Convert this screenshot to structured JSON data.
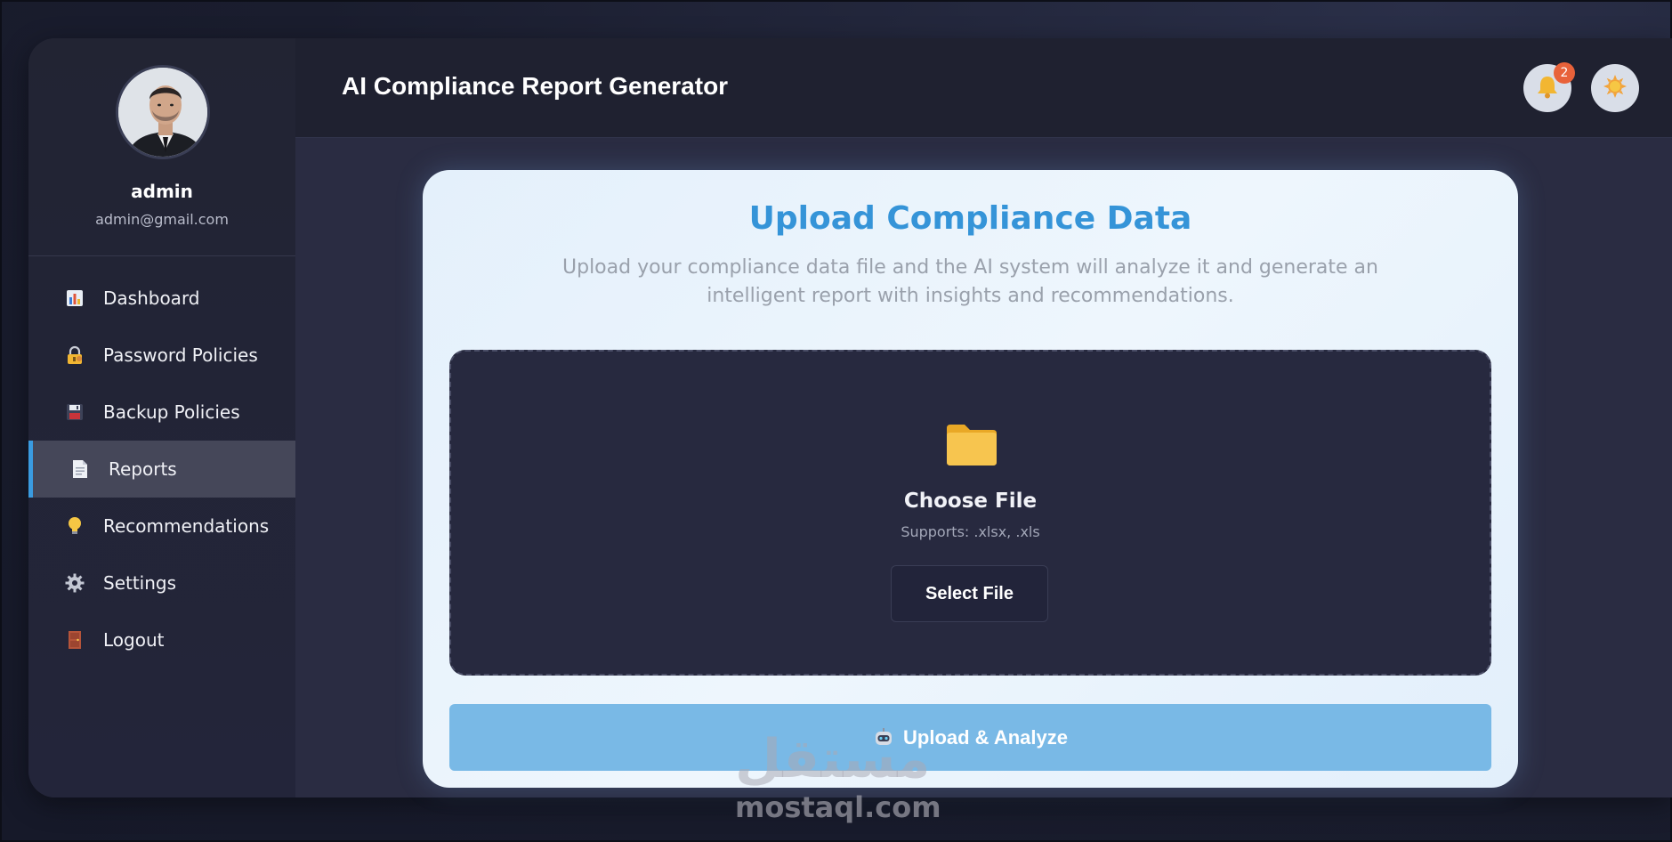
{
  "header": {
    "title": "AI Compliance Report Generator",
    "notification_count": "2"
  },
  "profile": {
    "name": "admin",
    "email": "admin@gmail.com"
  },
  "sidebar": {
    "items": [
      {
        "label": "Dashboard",
        "icon": "bar-chart-icon",
        "active": false
      },
      {
        "label": "Password Policies",
        "icon": "lock-key-icon",
        "active": false
      },
      {
        "label": "Backup Policies",
        "icon": "floppy-disk-icon",
        "active": false
      },
      {
        "label": "Reports",
        "icon": "document-icon",
        "active": true
      },
      {
        "label": "Recommendations",
        "icon": "lightbulb-icon",
        "active": false
      },
      {
        "label": "Settings",
        "icon": "gear-icon",
        "active": false
      },
      {
        "label": "Logout",
        "icon": "door-icon",
        "active": false
      }
    ]
  },
  "upload": {
    "title": "Upload Compliance Data",
    "description": "Upload your compliance data file and the AI system will analyze it and generate an intelligent report with insights and recommendations.",
    "choose_title": "Choose File",
    "supports": "Supports: .xlsx, .xls",
    "select_label": "Select File",
    "analyze_label": "Upload & Analyze"
  },
  "watermark": {
    "arabic": "مستقل",
    "latin": "mostaql.com"
  },
  "colors": {
    "accent": "#3a9be0",
    "title_blue": "#3594d8",
    "analyze_button": "#79b9e6",
    "badge": "#e8623a"
  }
}
